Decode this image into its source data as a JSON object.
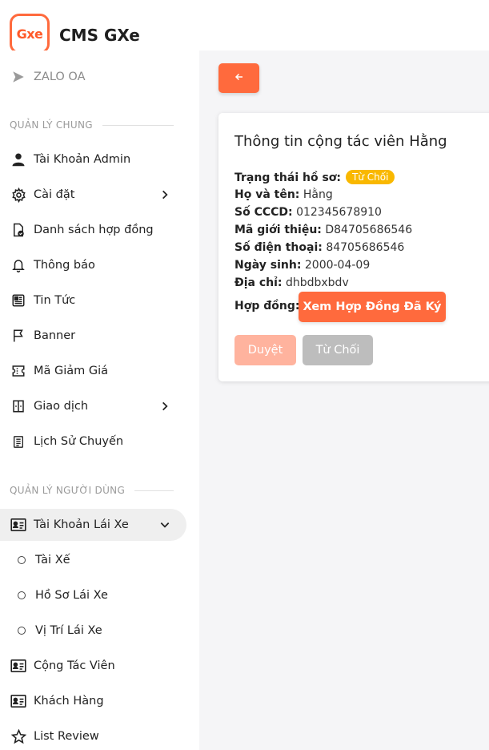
{
  "app": {
    "logo_text": "Gxe",
    "title": "CMS GXe"
  },
  "sidebar": {
    "zalo": "ZALO OA",
    "section_general": "QUẢN LÝ CHUNG",
    "general_items": [
      {
        "label": "Tài Khoản Admin",
        "icon": "user-icon"
      },
      {
        "label": "Cài đặt",
        "icon": "gear-icon"
      },
      {
        "label": "Danh sách hợp đồng",
        "icon": "contract-icon"
      },
      {
        "label": "Thông báo",
        "icon": "bell-icon"
      },
      {
        "label": "Tin Tức",
        "icon": "news-icon"
      },
      {
        "label": "Banner",
        "icon": "flag-icon"
      },
      {
        "label": "Mã Giảm Giá",
        "icon": "ticket-icon"
      },
      {
        "label": "Giao dịch",
        "icon": "transaction-icon"
      },
      {
        "label": "Lịch Sử Chuyến",
        "icon": "list-icon"
      }
    ],
    "section_users": "QUẢN LÝ NGƯỜI DÙNG",
    "user_items": [
      {
        "label": "Tài Khoản Lái Xe",
        "icon": "id-card-icon"
      },
      {
        "label": "Tài Xế"
      },
      {
        "label": "Hồ Sơ Lái Xe"
      },
      {
        "label": "Vị Trí Lái Xe"
      },
      {
        "label": "Cộng Tác Viên",
        "icon": "id-card-icon"
      },
      {
        "label": "Khách Hàng",
        "icon": "id-card-icon"
      },
      {
        "label": "List Review",
        "icon": "star-icon"
      }
    ]
  },
  "main": {
    "card_title": "Thông tin cộng tác viên Hằng",
    "fields": {
      "status_label": "Trạng thái hồ sơ:",
      "status_value": "Từ Chối",
      "name_label": "Họ và tên:",
      "name_value": "Hằng",
      "cccd_label": "Số CCCD:",
      "cccd_value": "012345678910",
      "referral_label": "Mã giới thiệu:",
      "referral_value": "D84705686546",
      "phone_label": "Số điện thoại:",
      "phone_value": "84705686546",
      "birth_label": "Ngày sinh:",
      "birth_value": "2000-04-09",
      "address_label": "Địa chỉ:",
      "address_value": "dhbdbxbdv",
      "contract_label": "Hợp đồng:"
    },
    "view_contract_label": "Xem Hợp Đồng Đã Ký",
    "approve_label": "Duyệt",
    "reject_label": "Từ Chối"
  },
  "colors": {
    "accent": "#ff6a3d",
    "badge": "#f9b800",
    "disabled_accent": "#ffb39e",
    "disabled_gray": "#bdbdbd"
  }
}
